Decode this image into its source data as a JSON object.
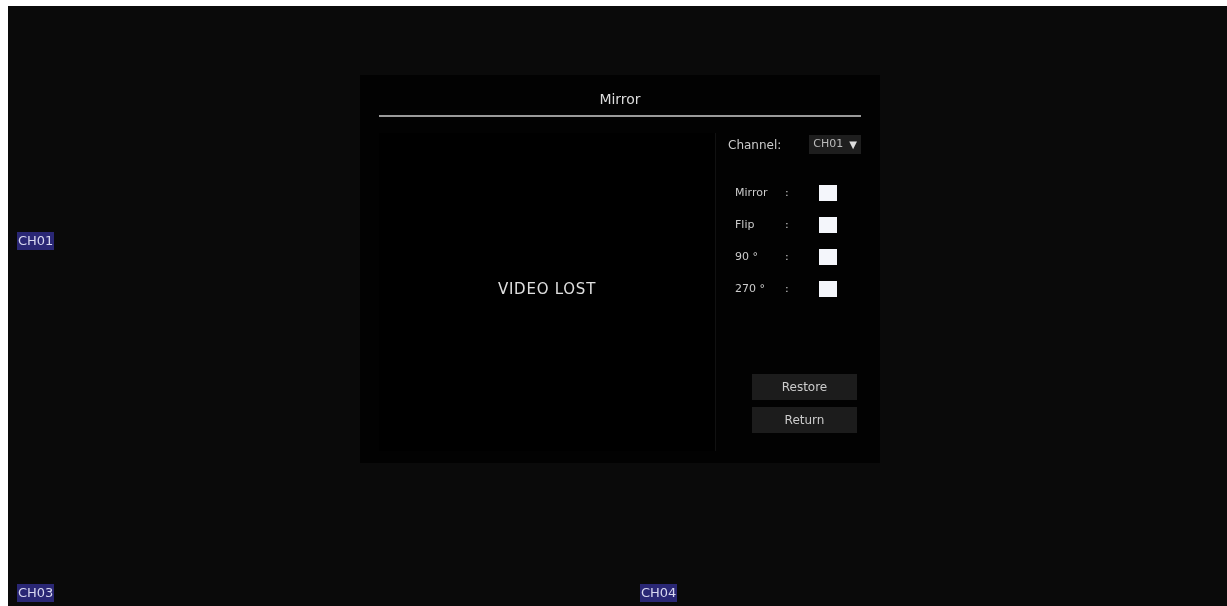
{
  "channel_labels": {
    "top_left": "CH01",
    "bottom_left": "CH03",
    "bottom_right": "CH04"
  },
  "dialog": {
    "title": "Mirror",
    "preview": {
      "text": "VIDEO LOST"
    },
    "channel": {
      "label": "Channel:",
      "value": "CH01",
      "arrow": "▼"
    },
    "options": [
      {
        "label": "Mirror",
        "separator": ":",
        "checked": false
      },
      {
        "label": "Flip",
        "separator": ":",
        "checked": false
      },
      {
        "label": "90 °",
        "separator": ":",
        "checked": false
      },
      {
        "label": "270 °",
        "separator": ":",
        "checked": false
      }
    ],
    "buttons": [
      "Restore",
      "Return"
    ]
  }
}
